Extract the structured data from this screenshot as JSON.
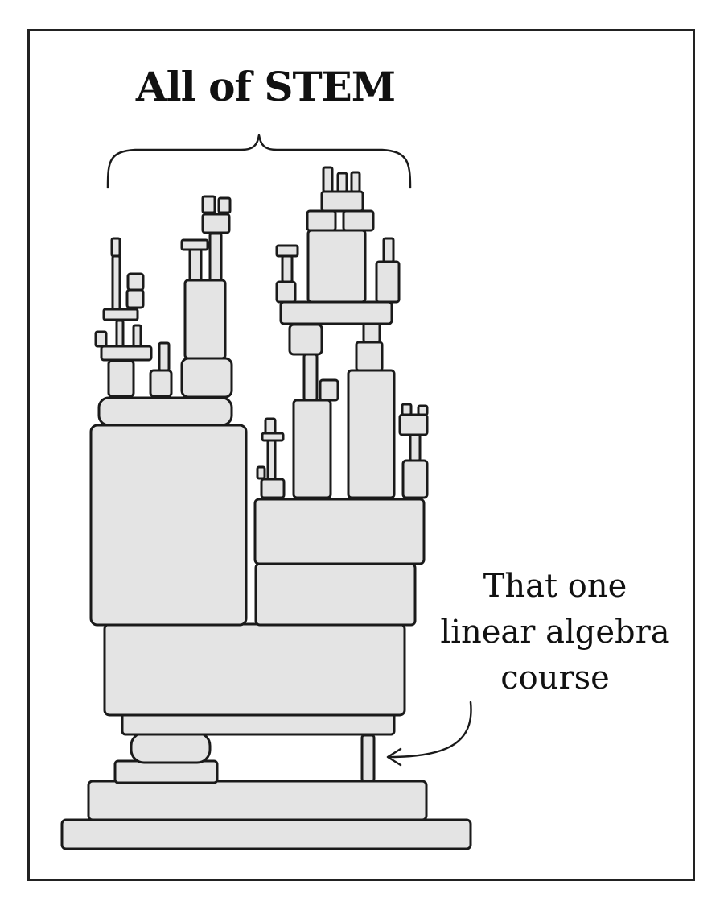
{
  "title": "All of STEM",
  "annotation": [
    "That one",
    "linear algebra",
    "course"
  ],
  "colors": {
    "block_fill": "#e4e4e4",
    "ink": "#1a1a1a",
    "background": "#ffffff"
  }
}
